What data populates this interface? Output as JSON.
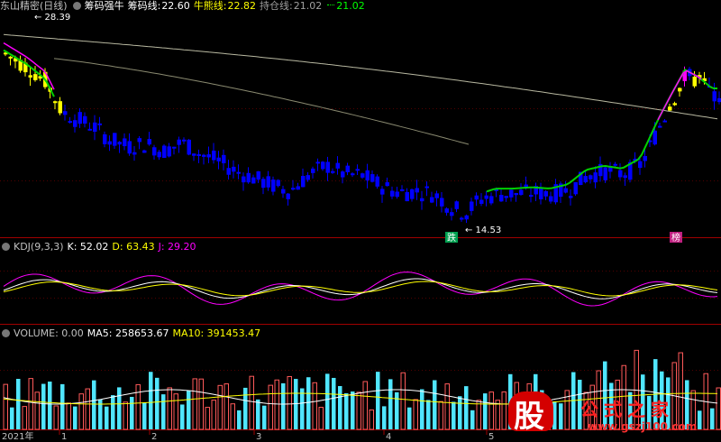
{
  "main_header": {
    "name": "东山精密(日线)",
    "items": [
      {
        "label": "筹码强牛",
        "value": "",
        "color": "#ffffff"
      },
      {
        "label": "筹码线:",
        "value": "22.60",
        "color": "#ffffff"
      },
      {
        "label": "牛熊线:",
        "value": "22.82",
        "color": "#ffff00"
      },
      {
        "label": "持仓线:",
        "value": "21.02",
        "color": "#a0a0a0"
      },
      {
        "label": "",
        "value": "21.02",
        "color": "#00ff00"
      }
    ]
  },
  "kdj_header": {
    "name": "KDJ(9,3,3)",
    "k": "K: 52.02",
    "d": "D: 63.43",
    "j": "J: 29.20"
  },
  "vol_header": {
    "name": "VOLUME: 0.00",
    "ma5": "MA5: 258653.67",
    "ma10": "MA10: 391453.47"
  },
  "annotations": {
    "high": "28.39",
    "low": "14.53",
    "sell_tag": "跌",
    "buy_tag": "榜"
  },
  "axis": {
    "year_label": "2021年",
    "months": [
      "1",
      "2",
      "3",
      "4",
      "5"
    ]
  },
  "watermark": {
    "glyph": "股",
    "site_name": "公式之家",
    "url": "www.gszj100.com"
  },
  "colors": {
    "up": "#ffff00",
    "down": "#0000ff",
    "green_band": "#00d000",
    "magenta": "#ff00ff",
    "vol_up": "#ff5a5a",
    "vol_down": "#50e6ff"
  },
  "chart_data": [
    {
      "type": "line",
      "title": "东山精密(日线)",
      "price_range": [
        14.53,
        28.39
      ],
      "x": [
        "2021-01",
        "2021-02",
        "2021-03",
        "2021-04",
        "2021-05"
      ],
      "close_approx": [
        26.5,
        22.0,
        18.5,
        15.5,
        21.0
      ],
      "series": [
        {
          "name": "筹码线",
          "last": 22.6
        },
        {
          "name": "牛熊线",
          "last": 22.82
        },
        {
          "name": "持仓线",
          "last": 21.02
        }
      ]
    },
    {
      "type": "line",
      "title": "KDJ(9,3,3)",
      "series": [
        {
          "name": "K",
          "last": 52.02
        },
        {
          "name": "D",
          "last": 63.43
        },
        {
          "name": "J",
          "last": 29.2
        }
      ]
    },
    {
      "type": "bar",
      "title": "VOLUME",
      "series": [
        {
          "name": "VOLUME",
          "last": 0.0
        },
        {
          "name": "MA5",
          "last": 258653.67
        },
        {
          "name": "MA10",
          "last": 391453.47
        }
      ]
    }
  ]
}
